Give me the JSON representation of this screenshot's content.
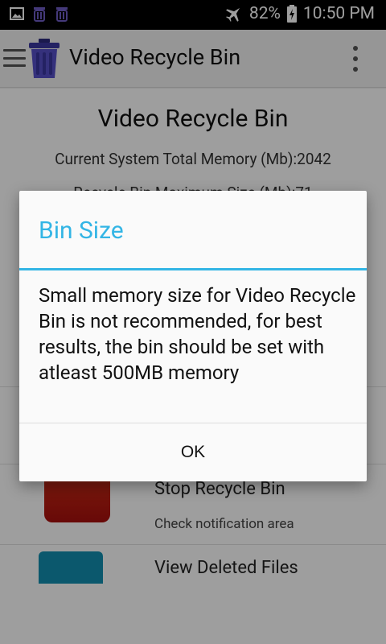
{
  "status_bar": {
    "battery": "82%",
    "time": "10:50 PM",
    "icons": [
      "image-icon",
      "recycle-bin-icon",
      "recycle-bin-icon",
      "airplane-icon",
      "battery-icon"
    ]
  },
  "app_bar": {
    "title": "Video Recycle Bin",
    "icons": [
      "menu-icon",
      "trash-bin-icon",
      "overflow-menu-icon"
    ]
  },
  "main": {
    "title": "Video Recycle Bin",
    "memory_total": "Current System Total Memory (Mb):2042",
    "memory_partial": "Recycle Bin Maximum Size (Mb):71",
    "rows": [
      {
        "title": "Stop Recycle Bin",
        "subtitle": "Check notification area"
      },
      {
        "title": "View Deleted Files",
        "subtitle": ""
      }
    ]
  },
  "dialog": {
    "title": "Bin Size",
    "message": "Small memory size for Video Recycle Bin is not recommended, for best results, the bin should be set with atleast 500MB memory",
    "ok_label": "OK",
    "accent_color": "#33b5e5"
  }
}
